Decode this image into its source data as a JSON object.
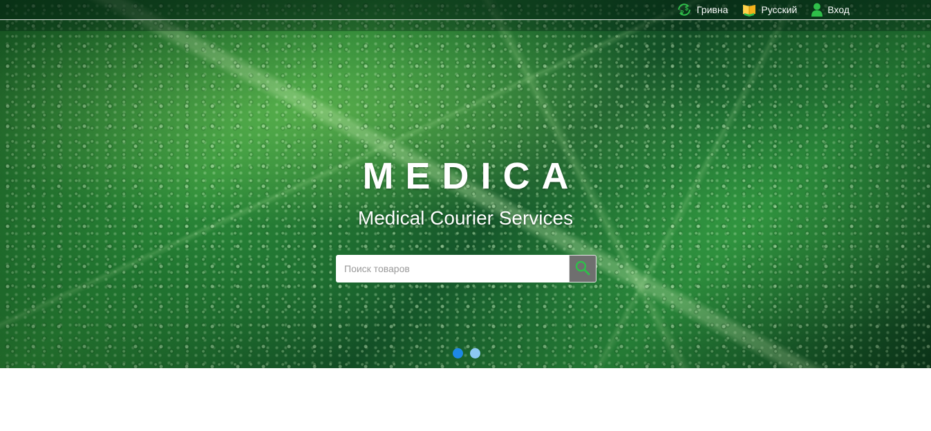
{
  "header": {
    "currency_label": "Гривна",
    "language_label": "Русский",
    "login_label": "Вход"
  },
  "hero": {
    "brand": "MEDICA",
    "tagline": "Medical Courier Services",
    "search": {
      "placeholder": "Поиск товаров",
      "value": ""
    },
    "slides": {
      "count": 2,
      "active_index": 0
    }
  },
  "icons": {
    "currency": "currency-exchange-icon",
    "language": "book-flag-icon",
    "login": "user-icon",
    "search": "magnifier-icon"
  },
  "colors": {
    "accent_green": "#2fbf4a",
    "dot_active": "#1e88e5",
    "dot_inactive": "#8cc8f2",
    "search_button_bg": "#6f6f6f"
  }
}
